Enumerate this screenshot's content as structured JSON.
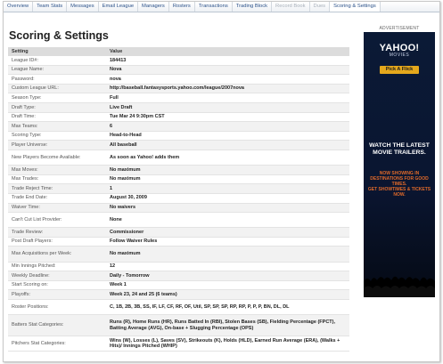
{
  "nav": {
    "items": [
      {
        "label": "Overview",
        "state": "normal"
      },
      {
        "label": "Team Stats",
        "state": "normal"
      },
      {
        "label": "Messages",
        "state": "normal"
      },
      {
        "label": "Email League",
        "state": "normal"
      },
      {
        "label": "Managers",
        "state": "normal"
      },
      {
        "label": "Rosters",
        "state": "normal"
      },
      {
        "label": "Transactions",
        "state": "normal"
      },
      {
        "label": "Trading Block",
        "state": "normal"
      },
      {
        "label": "Record Book",
        "state": "disabled"
      },
      {
        "label": "Dues",
        "state": "disabled"
      },
      {
        "label": "Scoring & Settings",
        "state": "active"
      }
    ]
  },
  "page": {
    "title": "Scoring & Settings"
  },
  "settings_table": {
    "header": {
      "setting": "Setting",
      "value": "Value"
    },
    "rows": [
      {
        "setting": "League ID#:",
        "value": "184413"
      },
      {
        "setting": "League Name:",
        "value": "Nova"
      },
      {
        "setting": "Password:",
        "value": "nova"
      },
      {
        "setting": "Custom League URL:",
        "value": "http://baseball.fantasysports.yahoo.com/league/2007nova"
      },
      {
        "setting": "Season Type:",
        "value": "Full"
      },
      {
        "setting": "Draft Type:",
        "value": "Live Draft"
      },
      {
        "setting": "Draft Time:",
        "value": "Tue Mar 24 9:30pm CST"
      },
      {
        "setting": "Max Teams:",
        "value": "6"
      },
      {
        "setting": "Scoring Type:",
        "value": "Head-to-Head"
      },
      {
        "setting": "Player Universe:",
        "value": "All baseball"
      },
      {
        "setting": "New Players Become Available:",
        "value": "As soon as Yahoo! adds them"
      },
      {
        "setting": "Max Moves:",
        "value": "No maximum"
      },
      {
        "setting": "Max Trades:",
        "value": "No maximum"
      },
      {
        "setting": "Trade Reject Time:",
        "value": "1"
      },
      {
        "setting": "Trade End Date:",
        "value": "August 30, 2009"
      },
      {
        "setting": "Waiver Time:",
        "value": "No waivers"
      },
      {
        "setting": "Can't Cut List Provider:",
        "value": "None"
      },
      {
        "setting": "Trade Review:",
        "value": "Commissioner"
      },
      {
        "setting": "Post Draft Players:",
        "value": "Follow Waiver Rules"
      },
      {
        "setting": "Max Acquisitions per Week:",
        "value": "No maximum"
      },
      {
        "setting": "Min Innings Pitched:",
        "value": "12"
      },
      {
        "setting": "Weekly Deadline:",
        "value": "Daily - Tomorrow"
      },
      {
        "setting": "Start Scoring on:",
        "value": "Week 1"
      },
      {
        "setting": "Playoffs:",
        "value": "Week 23, 24 and 25 (6 teams)"
      },
      {
        "setting": "Roster Positions:",
        "value": "C, 1B, 2B, 3B, SS, IF, LF, CF, RF, OF, Util, SP, SP, SP, RP, RP, P, P, P, BN, DL, DL"
      },
      {
        "setting": "Batters Stat Categories:",
        "value": "Runs (R), Home Runs (HR), Runs Batted In (RBI), Stolen Bases (SB), Fielding Percentage (FPCT), Batting Average (AVG), On-base + Slugging Percentage (OPS)"
      },
      {
        "setting": "Pitchers Stat Categories:",
        "value": "Wins (W), Losses (L), Saves (SV), Strikeouts (K), Holds (HLD), Earned Run Average (ERA), (Walks + Hits)/ Innings Pitched (WHIP)"
      }
    ]
  },
  "advertisement": {
    "label": "ADVERTISEMENT",
    "logo_text": "YAHOO!",
    "logo_sub": "MOVIES",
    "button_label": "Pick A Flick",
    "headline": "WATCH THE LATEST MOVIE TRAILERS.",
    "promo_1": "NOW SHOWING IN DESTINATIONS FOR GOOD TIMES.",
    "promo_2": "GET SHOWTIMES & TICKETS NOW."
  },
  "colors": {
    "nav_link": "#2b5189",
    "table_header_bg": "#dcdcdc",
    "ad_bg": "#0b1a36",
    "ad_button": "#e5a81c",
    "ad_promo": "#e06a2a"
  }
}
